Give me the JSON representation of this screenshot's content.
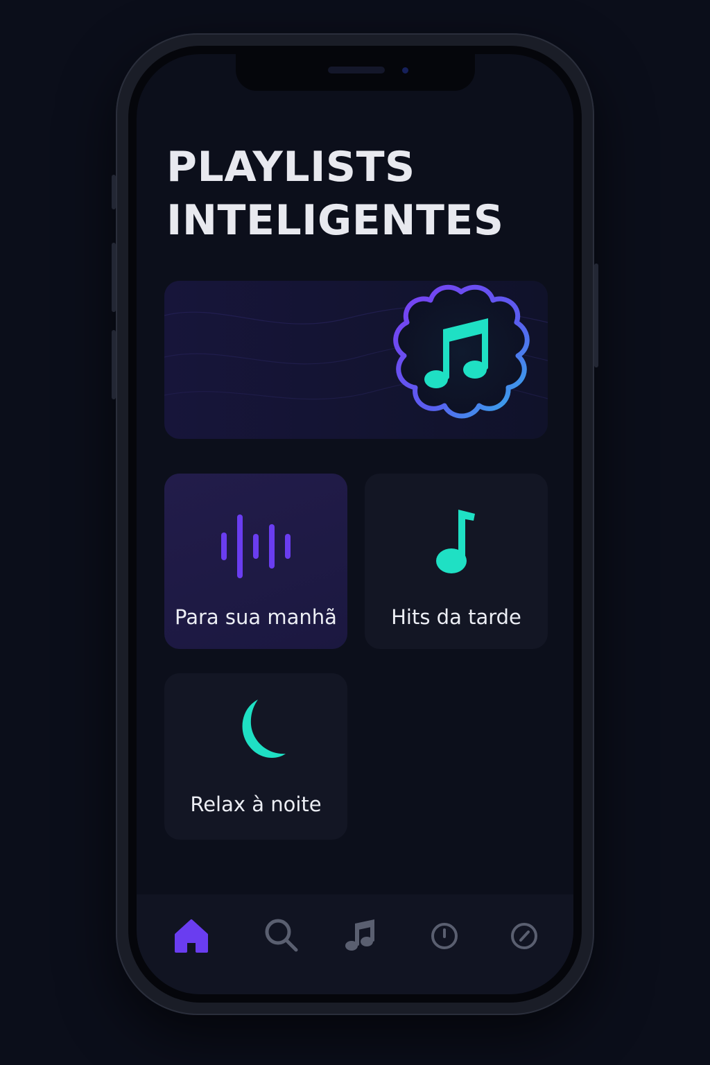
{
  "page": {
    "title_line1": "PLAYLISTS",
    "title_line2": "INTELIGENTES"
  },
  "hero": {
    "icon": "music-note-cloud-icon"
  },
  "cards": [
    {
      "label": "Para sua manhã",
      "icon": "sound-wave-icon"
    },
    {
      "label": "Hits da tarde",
      "icon": "music-note-icon"
    },
    {
      "label": "Relax à noite",
      "icon": "crescent-moon-icon"
    }
  ],
  "tabbar": {
    "items": [
      {
        "icon": "home-icon",
        "active": true
      },
      {
        "icon": "search-icon",
        "active": false
      },
      {
        "icon": "music-note-icon",
        "active": false
      },
      {
        "icon": "clock-icon",
        "active": false
      },
      {
        "icon": "compass-icon",
        "active": false
      }
    ]
  },
  "colors": {
    "background": "#0b0e1a",
    "accent_purple": "#6a3df0",
    "accent_teal": "#1fe0c4",
    "text": "#e8e9ef",
    "inactive_icon": "#5a5f70"
  }
}
